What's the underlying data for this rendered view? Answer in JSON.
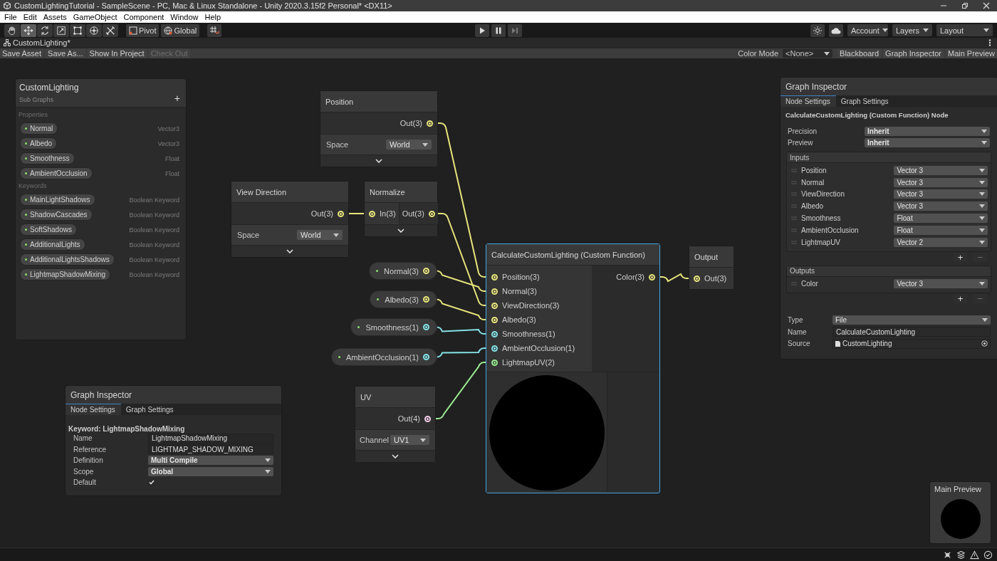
{
  "window": {
    "title": "CustomLightingTutorial - SampleScene - PC, Mac & Linux Standalone - Unity 2020.3.15f2 Personal* <DX11>"
  },
  "menu": [
    "File",
    "Edit",
    "Assets",
    "GameObject",
    "Component",
    "Window",
    "Help"
  ],
  "toolbar": {
    "tools": [
      {
        "selected": false
      },
      {
        "selected": true
      },
      {
        "selected": false
      },
      {
        "selected": false
      },
      {
        "selected": false
      },
      {
        "selected": false
      },
      {
        "selected": false
      }
    ],
    "pivot": "Pivot",
    "global": "Global",
    "dropdowns": [
      "Account",
      "Layers",
      "Layout"
    ]
  },
  "editor_tab": {
    "title": "CustomLighting*"
  },
  "graph_toolbar": {
    "actions": [
      {
        "label": "Save Asset",
        "disabled": false
      },
      {
        "label": "Save As...",
        "disabled": false
      },
      {
        "label": "Show In Project",
        "disabled": false
      },
      {
        "label": "Check Out",
        "disabled": true
      }
    ],
    "color_mode": {
      "label": "Color Mode",
      "value": "<None>"
    },
    "toggles": [
      "Blackboard",
      "Graph Inspector",
      "Main Preview"
    ]
  },
  "blackboard": {
    "title": "CustomLighting",
    "subtitle": "Sub Graphs",
    "add": "+",
    "sections": [
      {
        "title": "Properties",
        "items": [
          {
            "name": "Normal",
            "type": "Vector3"
          },
          {
            "name": "Albedo",
            "type": "Vector3"
          },
          {
            "name": "Smoothness",
            "type": "Float"
          },
          {
            "name": "AmbientOcclusion",
            "type": "Float"
          }
        ]
      },
      {
        "title": "Keywords",
        "items": [
          {
            "name": "MainLightShadows",
            "type": "Boolean Keyword"
          },
          {
            "name": "ShadowCascades",
            "type": "Boolean Keyword"
          },
          {
            "name": "SoftShadows",
            "type": "Boolean Keyword"
          },
          {
            "name": "AdditionalLights",
            "type": "Boolean Keyword"
          },
          {
            "name": "AdditionalLightsShadows",
            "type": "Boolean Keyword"
          },
          {
            "name": "LightmapShadowMixing",
            "type": "Boolean Keyword"
          }
        ]
      }
    ]
  },
  "nodes": [
    {
      "kind": "node",
      "title": "Position",
      "selected": false,
      "outputs": [
        {
          "label": "Out(3)",
          "color": "#e8e67c"
        }
      ],
      "fields": [
        {
          "label": "Space",
          "value": "World"
        }
      ],
      "expander": true
    },
    {
      "kind": "node",
      "title": "View Direction",
      "selected": false,
      "outputs": [
        {
          "label": "Out(3)",
          "color": "#e8e67c"
        }
      ],
      "fields": [
        {
          "label": "Space",
          "value": "World"
        }
      ],
      "expander": true
    },
    {
      "kind": "node",
      "title": "Normalize",
      "selected": false,
      "inputs": [
        {
          "label": "In(3)",
          "color": "#e8e67c"
        }
      ],
      "outputs": [
        {
          "label": "Out(3)",
          "color": "#e8e67c"
        }
      ],
      "expander": true
    },
    {
      "kind": "property",
      "selected": false,
      "outputs": [
        {
          "label": "Normal(3)",
          "color": "#e8e67c"
        }
      ]
    },
    {
      "kind": "property",
      "selected": false,
      "outputs": [
        {
          "label": "Albedo(3)",
          "color": "#e8e67c"
        }
      ]
    },
    {
      "kind": "property",
      "selected": false,
      "outputs": [
        {
          "label": "Smoothness(1)",
          "color": "#84e4e7"
        }
      ]
    },
    {
      "kind": "property",
      "selected": false,
      "outputs": [
        {
          "label": "AmbientOcclusion(1)",
          "color": "#84e4e7"
        }
      ]
    },
    {
      "kind": "function",
      "title": "CalculateCustomLighting (Custom Function)",
      "selected": true,
      "inputs": [
        {
          "label": "Position(3)",
          "color": "#e8e67c"
        },
        {
          "label": "Normal(3)",
          "color": "#e8e67c"
        },
        {
          "label": "ViewDirection(3)",
          "color": "#e8e67c"
        },
        {
          "label": "Albedo(3)",
          "color": "#e8e67c"
        },
        {
          "label": "Smoothness(1)",
          "color": "#84e4e7"
        },
        {
          "label": "AmbientOcclusion(1)",
          "color": "#84e4e7"
        },
        {
          "label": "LightmapUV(2)",
          "color": "#9aef92"
        }
      ],
      "outputs": [
        {
          "label": "Color(3)",
          "color": "#e8e67c"
        }
      ]
    },
    {
      "kind": "node",
      "title": "Output",
      "selected": false,
      "inputs": [
        {
          "label": "Out(3)",
          "color": "#e8e67c"
        }
      ],
      "expander": false
    },
    {
      "kind": "node",
      "title": "UV",
      "selected": false,
      "outputs": [
        {
          "label": "Out(4)",
          "color": "#f4cdea"
        }
      ],
      "fields": [
        {
          "label": "Channel",
          "value": "UV1"
        }
      ],
      "expander": true
    }
  ],
  "inspectors": [
    {
      "title": "Graph Inspector",
      "tabs": [
        {
          "label": "Node Settings",
          "selected": true
        },
        {
          "label": "Graph Settings",
          "selected": false
        }
      ],
      "heading": "Keyword: LightmapShadowMixing",
      "rows": [
        {
          "kind": "text",
          "label": "Name",
          "value": "LightmapShadowMixing"
        },
        {
          "kind": "text",
          "label": "Reference",
          "value": "LIGHTMAP_SHADOW_MIXING"
        },
        {
          "kind": "dropdown",
          "label": "Definition",
          "value": "Multi Compile"
        },
        {
          "kind": "dropdown",
          "label": "Scope",
          "value": "Global"
        },
        {
          "kind": "checkbox",
          "label": "Default",
          "checked": true
        }
      ]
    },
    {
      "title": "Graph Inspector",
      "tabs": [
        {
          "label": "Node Settings",
          "selected": true
        },
        {
          "label": "Graph Settings",
          "selected": false
        }
      ],
      "heading": "CalculateCustomLighting (Custom Function) Node",
      "rows": [
        {
          "kind": "dropdown",
          "label": "Precision",
          "value": "Inherit"
        },
        {
          "kind": "dropdown",
          "label": "Preview",
          "value": "Inherit"
        },
        {
          "kind": "list",
          "label": "Inputs",
          "items": [
            {
              "name": "Position",
              "type": "Vector 3"
            },
            {
              "name": "Normal",
              "type": "Vector 3"
            },
            {
              "name": "ViewDirection",
              "type": "Vector 3"
            },
            {
              "name": "Albedo",
              "type": "Vector 3"
            },
            {
              "name": "Smoothness",
              "type": "Float"
            },
            {
              "name": "AmbientOcclusion",
              "type": "Float"
            },
            {
              "name": "LightmapUV",
              "type": "Vector 2"
            }
          ],
          "add": "+",
          "remove": "−"
        },
        {
          "kind": "list",
          "label": "Outputs",
          "items": [
            {
              "name": "Color",
              "type": "Vector 3"
            }
          ],
          "add": "+",
          "remove": "−"
        },
        {
          "kind": "plaindropdown",
          "label": "Type",
          "value": "File"
        },
        {
          "kind": "text",
          "label": "Name",
          "value": "CalculateCustomLighting"
        },
        {
          "kind": "object",
          "label": "Source",
          "value": "CustomLighting"
        }
      ]
    }
  ],
  "main_preview": {
    "title": "Main Preview"
  }
}
